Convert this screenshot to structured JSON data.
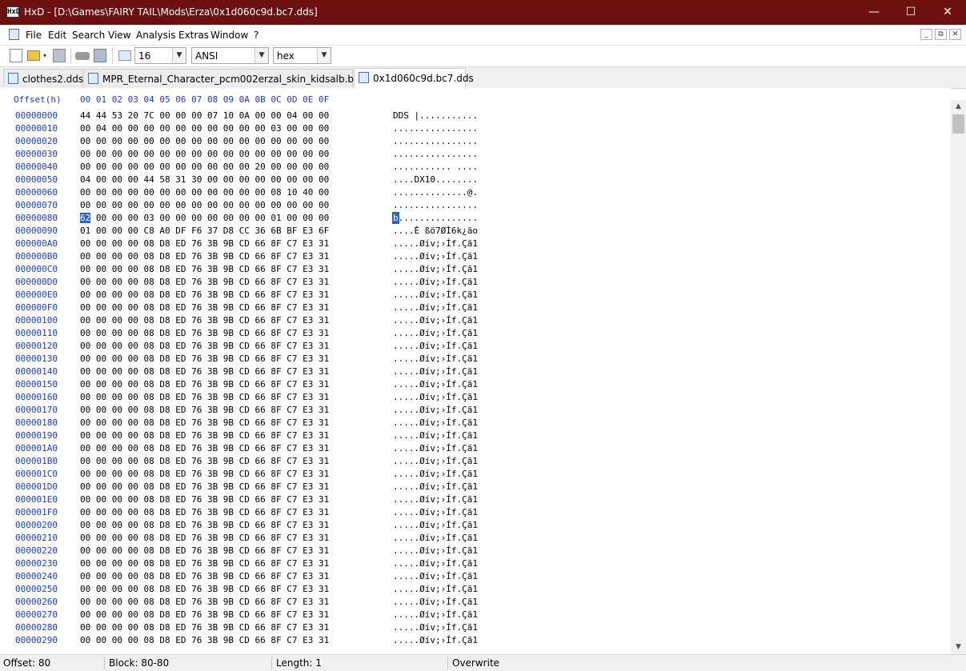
{
  "window": {
    "app_icon": "HxD",
    "title": "HxD - [D:\\Games\\FAIRY TAIL\\Mods\\Erza\\0x1d060c9d.bc7.dds]",
    "min_symbol": "—",
    "max_symbol": "☐",
    "close_symbol": "✕",
    "titlebar_color": "#6d1010"
  },
  "menu": {
    "items": [
      "File",
      "Edit",
      "Search",
      "View",
      "Analysis",
      "Extras",
      "Window",
      "?"
    ],
    "mdi": [
      "_",
      "⧉",
      "✕"
    ]
  },
  "toolbar": {
    "bytes_per_row": "16",
    "charset": "ANSI",
    "offset_base": "hex",
    "icons": [
      "new-file-icon",
      "open-file-icon",
      "save-icon",
      "open-disk-icon",
      "open-ram-icon",
      "bytes-per-row-icon"
    ]
  },
  "tabs": [
    {
      "label": "clothes2.dds",
      "active": false
    },
    {
      "label": "MPR_Eternal_Character_pcm002erzal_skin_kidsalb.bc7.dds",
      "active": false
    },
    {
      "label": "0x1d060c9d.bc7.dds",
      "active": true
    }
  ],
  "editor": {
    "header_offset": "Offset(h)",
    "header_columns": "00 01 02 03 04 05 06 07 08 09 0A 0B 0C 0D 0E 0F",
    "rows": [
      {
        "off": "00000000",
        "hex": "44 44 53 20 7C 00 00 00 07 10 0A 00 00 04 00 00",
        "txt": "DDS |..........."
      },
      {
        "off": "00000010",
        "hex": "00 04 00 00 00 00 00 00 00 00 00 00 03 00 00 00",
        "txt": "................"
      },
      {
        "off": "00000020",
        "hex": "00 00 00 00 00 00 00 00 00 00 00 00 00 00 00 00",
        "txt": "................"
      },
      {
        "off": "00000030",
        "hex": "00 00 00 00 00 00 00 00 00 00 00 00 00 00 00 00",
        "txt": "................"
      },
      {
        "off": "00000040",
        "hex": "00 00 00 00 00 00 00 00 00 00 00 20 00 00 00 00",
        "txt": "........... ...."
      },
      {
        "off": "00000050",
        "hex": "04 00 00 00 44 58 31 30 00 00 00 00 00 00 00 00",
        "txt": "....DX10........"
      },
      {
        "off": "00000060",
        "hex": "00 00 00 00 00 00 00 00 00 00 00 00 08 10 40 00",
        "txt": "..............@."
      },
      {
        "off": "00000070",
        "hex": "00 00 00 00 00 00 00 00 00 00 00 00 00 00 00 00",
        "txt": "................"
      },
      {
        "off": "00000080",
        "hex": "62 00 00 00 03 00 00 00 00 00 00 00 01 00 00 00",
        "txt": "b...............",
        "selected_byte": "62",
        "selected_char": "b"
      },
      {
        "off": "00000090",
        "hex": "01 00 00 00 C8 A0 DF F6 37 D8 CC 36 6B BF E3 6F",
        "txt": "....È ßö7ØÌ6k¿ão"
      },
      {
        "off": "000000A0",
        "hex": "00 00 00 00 08 D8 ED 76 3B 9B CD 66 8F C7 E3 31",
        "txt": ".....Øív;›Íf.Çã1"
      },
      {
        "off": "000000B0",
        "hex": "00 00 00 00 08 D8 ED 76 3B 9B CD 66 8F C7 E3 31",
        "txt": ".....Øív;›Íf.Çã1"
      },
      {
        "off": "000000C0",
        "hex": "00 00 00 00 08 D8 ED 76 3B 9B CD 66 8F C7 E3 31",
        "txt": ".....Øív;›Íf.Çã1"
      },
      {
        "off": "000000D0",
        "hex": "00 00 00 00 08 D8 ED 76 3B 9B CD 66 8F C7 E3 31",
        "txt": ".....Øív;›Íf.Çã1"
      },
      {
        "off": "000000E0",
        "hex": "00 00 00 00 08 D8 ED 76 3B 9B CD 66 8F C7 E3 31",
        "txt": ".....Øív;›Íf.Çã1"
      },
      {
        "off": "000000F0",
        "hex": "00 00 00 00 08 D8 ED 76 3B 9B CD 66 8F C7 E3 31",
        "txt": ".....Øív;›Íf.Çã1"
      },
      {
        "off": "00000100",
        "hex": "00 00 00 00 08 D8 ED 76 3B 9B CD 66 8F C7 E3 31",
        "txt": ".....Øív;›Íf.Çã1"
      },
      {
        "off": "00000110",
        "hex": "00 00 00 00 08 D8 ED 76 3B 9B CD 66 8F C7 E3 31",
        "txt": ".....Øív;›Íf.Çã1"
      },
      {
        "off": "00000120",
        "hex": "00 00 00 00 08 D8 ED 76 3B 9B CD 66 8F C7 E3 31",
        "txt": ".....Øív;›Íf.Çã1"
      },
      {
        "off": "00000130",
        "hex": "00 00 00 00 08 D8 ED 76 3B 9B CD 66 8F C7 E3 31",
        "txt": ".....Øív;›Íf.Çã1"
      },
      {
        "off": "00000140",
        "hex": "00 00 00 00 08 D8 ED 76 3B 9B CD 66 8F C7 E3 31",
        "txt": ".....Øív;›Íf.Çã1"
      },
      {
        "off": "00000150",
        "hex": "00 00 00 00 08 D8 ED 76 3B 9B CD 66 8F C7 E3 31",
        "txt": ".....Øív;›Íf.Çã1"
      },
      {
        "off": "00000160",
        "hex": "00 00 00 00 08 D8 ED 76 3B 9B CD 66 8F C7 E3 31",
        "txt": ".....Øív;›Íf.Çã1"
      },
      {
        "off": "00000170",
        "hex": "00 00 00 00 08 D8 ED 76 3B 9B CD 66 8F C7 E3 31",
        "txt": ".....Øív;›Íf.Çã1"
      },
      {
        "off": "00000180",
        "hex": "00 00 00 00 08 D8 ED 76 3B 9B CD 66 8F C7 E3 31",
        "txt": ".....Øív;›Íf.Çã1"
      },
      {
        "off": "00000190",
        "hex": "00 00 00 00 08 D8 ED 76 3B 9B CD 66 8F C7 E3 31",
        "txt": ".....Øív;›Íf.Çã1"
      },
      {
        "off": "000001A0",
        "hex": "00 00 00 00 08 D8 ED 76 3B 9B CD 66 8F C7 E3 31",
        "txt": ".....Øív;›Íf.Çã1"
      },
      {
        "off": "000001B0",
        "hex": "00 00 00 00 08 D8 ED 76 3B 9B CD 66 8F C7 E3 31",
        "txt": ".....Øív;›Íf.Çã1"
      },
      {
        "off": "000001C0",
        "hex": "00 00 00 00 08 D8 ED 76 3B 9B CD 66 8F C7 E3 31",
        "txt": ".....Øív;›Íf.Çã1"
      },
      {
        "off": "000001D0",
        "hex": "00 00 00 00 08 D8 ED 76 3B 9B CD 66 8F C7 E3 31",
        "txt": ".....Øív;›Íf.Çã1"
      },
      {
        "off": "000001E0",
        "hex": "00 00 00 00 08 D8 ED 76 3B 9B CD 66 8F C7 E3 31",
        "txt": ".....Øív;›Íf.Çã1"
      },
      {
        "off": "000001F0",
        "hex": "00 00 00 00 08 D8 ED 76 3B 9B CD 66 8F C7 E3 31",
        "txt": ".....Øív;›Íf.Çã1"
      },
      {
        "off": "00000200",
        "hex": "00 00 00 00 08 D8 ED 76 3B 9B CD 66 8F C7 E3 31",
        "txt": ".....Øív;›Íf.Çã1"
      },
      {
        "off": "00000210",
        "hex": "00 00 00 00 08 D8 ED 76 3B 9B CD 66 8F C7 E3 31",
        "txt": ".....Øív;›Íf.Çã1"
      },
      {
        "off": "00000220",
        "hex": "00 00 00 00 08 D8 ED 76 3B 9B CD 66 8F C7 E3 31",
        "txt": ".....Øív;›Íf.Çã1"
      },
      {
        "off": "00000230",
        "hex": "00 00 00 00 08 D8 ED 76 3B 9B CD 66 8F C7 E3 31",
        "txt": ".....Øív;›Íf.Çã1"
      },
      {
        "off": "00000240",
        "hex": "00 00 00 00 08 D8 ED 76 3B 9B CD 66 8F C7 E3 31",
        "txt": ".....Øív;›Íf.Çã1"
      },
      {
        "off": "00000250",
        "hex": "00 00 00 00 08 D8 ED 76 3B 9B CD 66 8F C7 E3 31",
        "txt": ".....Øív;›Íf.Çã1"
      },
      {
        "off": "00000260",
        "hex": "00 00 00 00 08 D8 ED 76 3B 9B CD 66 8F C7 E3 31",
        "txt": ".....Øív;›Íf.Çã1"
      },
      {
        "off": "00000270",
        "hex": "00 00 00 00 08 D8 ED 76 3B 9B CD 66 8F C7 E3 31",
        "txt": ".....Øív;›Íf.Çã1"
      },
      {
        "off": "00000280",
        "hex": "00 00 00 00 08 D8 ED 76 3B 9B CD 66 8F C7 E3 31",
        "txt": ".....Øív;›Íf.Çã1"
      },
      {
        "off": "00000290",
        "hex": "00 00 00 00 08 D8 ED 76 3B 9B CD 66 8F C7 E3 31",
        "txt": ".....Øív;›Íf.Çã1"
      }
    ]
  },
  "status": {
    "offset": "Offset: 80",
    "block": "Block: 80-80",
    "length": "Length: 1",
    "mode": "Overwrite"
  }
}
